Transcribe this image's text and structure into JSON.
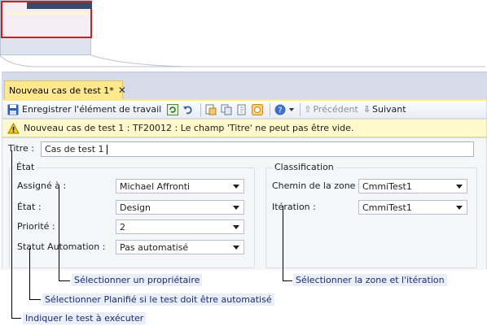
{
  "tab": {
    "title": "Nouveau cas de test 1*",
    "close_glyph": "✕"
  },
  "toolbar": {
    "save_label": "Enregistrer l'élément de travail",
    "previous_label": "Précédent",
    "next_label": "Suivant",
    "previous_arrow": "⇧",
    "next_arrow": "⇩"
  },
  "warning": {
    "text": "Nouveau cas de test 1 : TF20012 : Le champ 'Titre' ne peut pas être vide.",
    "icon": "warning-icon"
  },
  "form": {
    "title_label": "Titre :",
    "title_value": "Cas de test 1",
    "state_group": {
      "title": "État",
      "fields": [
        {
          "label": "Assigné à :",
          "value": "Michael Affronti"
        },
        {
          "label": "État :",
          "value": "Design"
        },
        {
          "label": "Priorité :",
          "value": "2"
        },
        {
          "label": "Statut Automation :",
          "value": "Pas automatisé"
        }
      ]
    },
    "classification_group": {
      "title": "Classification",
      "fields": [
        {
          "label": "Chemin de la zone :",
          "value": "CmmiTest1"
        },
        {
          "label": "Itération :",
          "value": "CmmiTest1"
        }
      ]
    }
  },
  "callouts": {
    "owner": "Sélectionner un propriétaire",
    "area_iteration": "Sélectionner la zone et l'itération",
    "automated": "Sélectionner Planifié si le test doit être automatisé",
    "test_to_run": "Indiquer le test à exécuter"
  },
  "colors": {
    "tab_active": "#ffe98c",
    "warning_bg": "#fff9cc",
    "callout_text": "#1a2d6b",
    "zoom_highlight": "#cc1f1f"
  }
}
